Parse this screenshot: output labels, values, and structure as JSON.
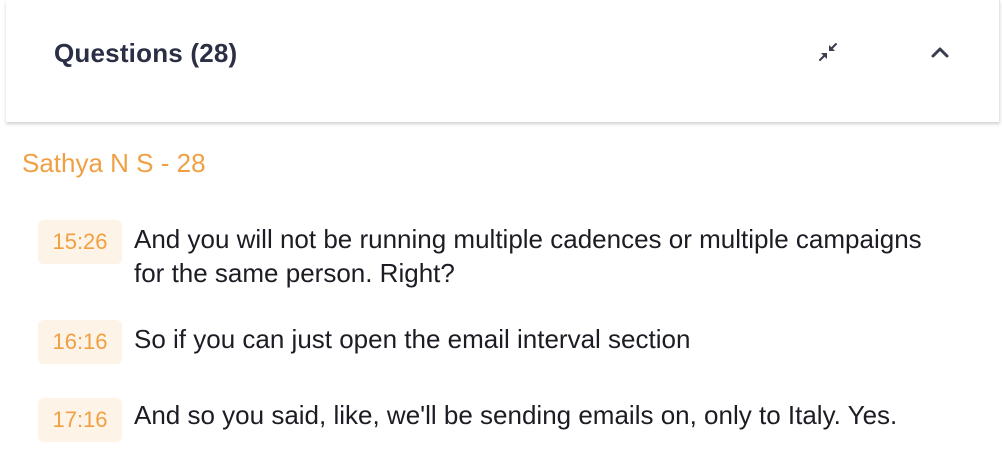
{
  "panel": {
    "title": "Questions (28)",
    "collapse_icon": "collapse-arrows-icon",
    "toggle_icon": "chevron-up-icon"
  },
  "group": {
    "speaker_label": "Sathya N S - 28",
    "questions": [
      {
        "time": "15:26",
        "text": "And you will not be running multiple cadences or multiple campaigns for the same person. Right?"
      },
      {
        "time": "16:16",
        "text": "So if you can just open the email interval section"
      },
      {
        "time": "17:16",
        "text": "And so you said, like, we'll be sending emails on, only to Italy. Yes."
      }
    ]
  },
  "colors": {
    "accent": "#f0a043",
    "timestamp_bg": "#fdf3e7",
    "title_text": "#2b2f45",
    "body_text": "#1c1c24"
  }
}
